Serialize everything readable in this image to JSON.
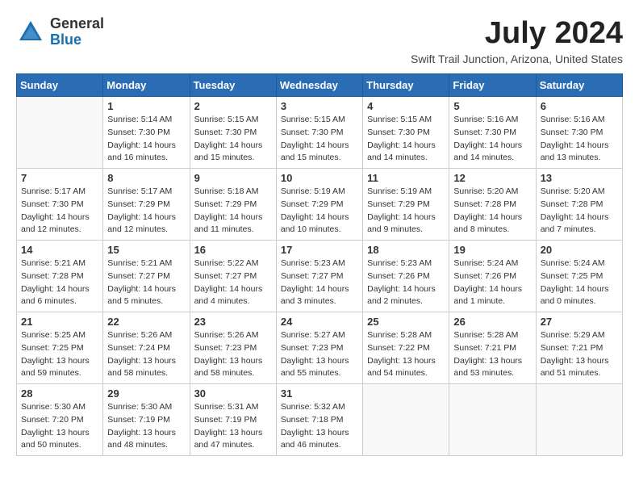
{
  "logo": {
    "text_general": "General",
    "text_blue": "Blue"
  },
  "title": "July 2024",
  "location": "Swift Trail Junction, Arizona, United States",
  "weekdays": [
    "Sunday",
    "Monday",
    "Tuesday",
    "Wednesday",
    "Thursday",
    "Friday",
    "Saturday"
  ],
  "weeks": [
    [
      {
        "day": "",
        "info": ""
      },
      {
        "day": "1",
        "info": "Sunrise: 5:14 AM\nSunset: 7:30 PM\nDaylight: 14 hours\nand 16 minutes."
      },
      {
        "day": "2",
        "info": "Sunrise: 5:15 AM\nSunset: 7:30 PM\nDaylight: 14 hours\nand 15 minutes."
      },
      {
        "day": "3",
        "info": "Sunrise: 5:15 AM\nSunset: 7:30 PM\nDaylight: 14 hours\nand 15 minutes."
      },
      {
        "day": "4",
        "info": "Sunrise: 5:15 AM\nSunset: 7:30 PM\nDaylight: 14 hours\nand 14 minutes."
      },
      {
        "day": "5",
        "info": "Sunrise: 5:16 AM\nSunset: 7:30 PM\nDaylight: 14 hours\nand 14 minutes."
      },
      {
        "day": "6",
        "info": "Sunrise: 5:16 AM\nSunset: 7:30 PM\nDaylight: 14 hours\nand 13 minutes."
      }
    ],
    [
      {
        "day": "7",
        "info": "Sunrise: 5:17 AM\nSunset: 7:30 PM\nDaylight: 14 hours\nand 12 minutes."
      },
      {
        "day": "8",
        "info": "Sunrise: 5:17 AM\nSunset: 7:29 PM\nDaylight: 14 hours\nand 12 minutes."
      },
      {
        "day": "9",
        "info": "Sunrise: 5:18 AM\nSunset: 7:29 PM\nDaylight: 14 hours\nand 11 minutes."
      },
      {
        "day": "10",
        "info": "Sunrise: 5:19 AM\nSunset: 7:29 PM\nDaylight: 14 hours\nand 10 minutes."
      },
      {
        "day": "11",
        "info": "Sunrise: 5:19 AM\nSunset: 7:29 PM\nDaylight: 14 hours\nand 9 minutes."
      },
      {
        "day": "12",
        "info": "Sunrise: 5:20 AM\nSunset: 7:28 PM\nDaylight: 14 hours\nand 8 minutes."
      },
      {
        "day": "13",
        "info": "Sunrise: 5:20 AM\nSunset: 7:28 PM\nDaylight: 14 hours\nand 7 minutes."
      }
    ],
    [
      {
        "day": "14",
        "info": "Sunrise: 5:21 AM\nSunset: 7:28 PM\nDaylight: 14 hours\nand 6 minutes."
      },
      {
        "day": "15",
        "info": "Sunrise: 5:21 AM\nSunset: 7:27 PM\nDaylight: 14 hours\nand 5 minutes."
      },
      {
        "day": "16",
        "info": "Sunrise: 5:22 AM\nSunset: 7:27 PM\nDaylight: 14 hours\nand 4 minutes."
      },
      {
        "day": "17",
        "info": "Sunrise: 5:23 AM\nSunset: 7:27 PM\nDaylight: 14 hours\nand 3 minutes."
      },
      {
        "day": "18",
        "info": "Sunrise: 5:23 AM\nSunset: 7:26 PM\nDaylight: 14 hours\nand 2 minutes."
      },
      {
        "day": "19",
        "info": "Sunrise: 5:24 AM\nSunset: 7:26 PM\nDaylight: 14 hours\nand 1 minute."
      },
      {
        "day": "20",
        "info": "Sunrise: 5:24 AM\nSunset: 7:25 PM\nDaylight: 14 hours\nand 0 minutes."
      }
    ],
    [
      {
        "day": "21",
        "info": "Sunrise: 5:25 AM\nSunset: 7:25 PM\nDaylight: 13 hours\nand 59 minutes."
      },
      {
        "day": "22",
        "info": "Sunrise: 5:26 AM\nSunset: 7:24 PM\nDaylight: 13 hours\nand 58 minutes."
      },
      {
        "day": "23",
        "info": "Sunrise: 5:26 AM\nSunset: 7:23 PM\nDaylight: 13 hours\nand 58 minutes."
      },
      {
        "day": "24",
        "info": "Sunrise: 5:27 AM\nSunset: 7:23 PM\nDaylight: 13 hours\nand 55 minutes."
      },
      {
        "day": "25",
        "info": "Sunrise: 5:28 AM\nSunset: 7:22 PM\nDaylight: 13 hours\nand 54 minutes."
      },
      {
        "day": "26",
        "info": "Sunrise: 5:28 AM\nSunset: 7:21 PM\nDaylight: 13 hours\nand 53 minutes."
      },
      {
        "day": "27",
        "info": "Sunrise: 5:29 AM\nSunset: 7:21 PM\nDaylight: 13 hours\nand 51 minutes."
      }
    ],
    [
      {
        "day": "28",
        "info": "Sunrise: 5:30 AM\nSunset: 7:20 PM\nDaylight: 13 hours\nand 50 minutes."
      },
      {
        "day": "29",
        "info": "Sunrise: 5:30 AM\nSunset: 7:19 PM\nDaylight: 13 hours\nand 48 minutes."
      },
      {
        "day": "30",
        "info": "Sunrise: 5:31 AM\nSunset: 7:19 PM\nDaylight: 13 hours\nand 47 minutes."
      },
      {
        "day": "31",
        "info": "Sunrise: 5:32 AM\nSunset: 7:18 PM\nDaylight: 13 hours\nand 46 minutes."
      },
      {
        "day": "",
        "info": ""
      },
      {
        "day": "",
        "info": ""
      },
      {
        "day": "",
        "info": ""
      }
    ]
  ]
}
